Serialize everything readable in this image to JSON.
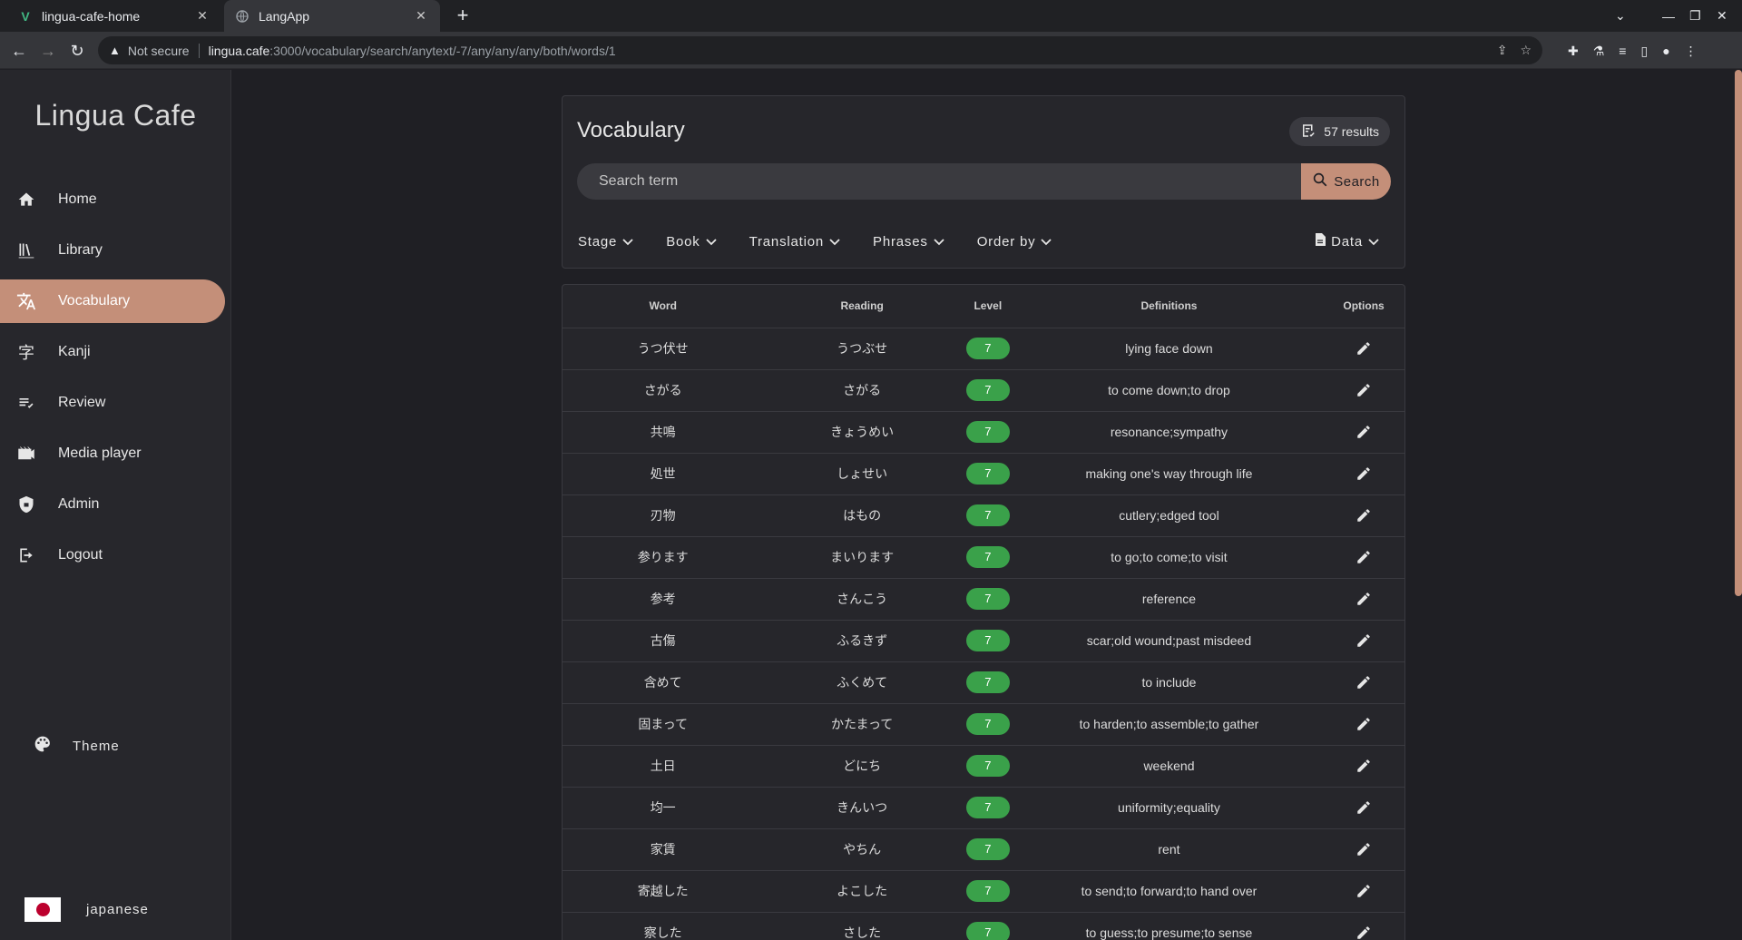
{
  "browser": {
    "tabs": [
      {
        "title": "lingua-cafe-home",
        "active": false,
        "favicon": "vue-icon"
      },
      {
        "title": "LangApp",
        "active": true,
        "favicon": "globe-icon"
      }
    ],
    "not_secure": "Not secure",
    "url_host": "lingua.cafe",
    "url_path": ":3000/vocabulary/search/anytext/-7/any/any/any/both/words/1"
  },
  "sidebar": {
    "brand": "Lingua Cafe",
    "items": [
      {
        "label": "Home",
        "icon": "home-icon"
      },
      {
        "label": "Library",
        "icon": "library-icon"
      },
      {
        "label": "Vocabulary",
        "icon": "translate-icon",
        "active": true
      },
      {
        "label": "Kanji",
        "icon": "kanji-icon"
      },
      {
        "label": "Review",
        "icon": "review-icon"
      },
      {
        "label": "Media player",
        "icon": "media-icon"
      },
      {
        "label": "Admin",
        "icon": "shield-icon"
      },
      {
        "label": "Logout",
        "icon": "logout-icon"
      }
    ],
    "theme_label": "Theme",
    "language_label": "japanese"
  },
  "vocab": {
    "title": "Vocabulary",
    "results": "57 results",
    "search_placeholder": "Search term",
    "search_label": "Search",
    "filters": [
      "Stage",
      "Book",
      "Translation",
      "Phrases",
      "Order by"
    ],
    "data_label": "Data"
  },
  "table": {
    "headers": [
      "Word",
      "Reading",
      "Level",
      "Definitions",
      "Options"
    ],
    "rows": [
      {
        "word": "うつ伏せ",
        "reading": "うつぶせ",
        "level": "7",
        "definition": "lying face down"
      },
      {
        "word": "さがる",
        "reading": "さがる",
        "level": "7",
        "definition": "to come down;to drop"
      },
      {
        "word": "共鳴",
        "reading": "きょうめい",
        "level": "7",
        "definition": "resonance;sympathy"
      },
      {
        "word": "処世",
        "reading": "しょせい",
        "level": "7",
        "definition": "making one's way through life"
      },
      {
        "word": "刃物",
        "reading": "はもの",
        "level": "7",
        "definition": "cutlery;edged tool"
      },
      {
        "word": "参ります",
        "reading": "まいります",
        "level": "7",
        "definition": "to go;to come;to visit"
      },
      {
        "word": "参考",
        "reading": "さんこう",
        "level": "7",
        "definition": "reference"
      },
      {
        "word": "古傷",
        "reading": "ふるきず",
        "level": "7",
        "definition": "scar;old wound;past misdeed"
      },
      {
        "word": "含めて",
        "reading": "ふくめて",
        "level": "7",
        "definition": "to include"
      },
      {
        "word": "固まって",
        "reading": "かたまって",
        "level": "7",
        "definition": "to harden;to assemble;to gather"
      },
      {
        "word": "土日",
        "reading": "どにち",
        "level": "7",
        "definition": "weekend"
      },
      {
        "word": "均一",
        "reading": "きんいつ",
        "level": "7",
        "definition": "uniformity;equality"
      },
      {
        "word": "家賃",
        "reading": "やちん",
        "level": "7",
        "definition": "rent"
      },
      {
        "word": "寄越した",
        "reading": "よこした",
        "level": "7",
        "definition": "to send;to forward;to hand over"
      },
      {
        "word": "察した",
        "reading": "さした",
        "level": "7",
        "definition": "to guess;to presume;to sense"
      }
    ]
  },
  "colors": {
    "accent": "#c48f79",
    "level_badge": "#3aa14a",
    "background": "#1f1f24"
  }
}
